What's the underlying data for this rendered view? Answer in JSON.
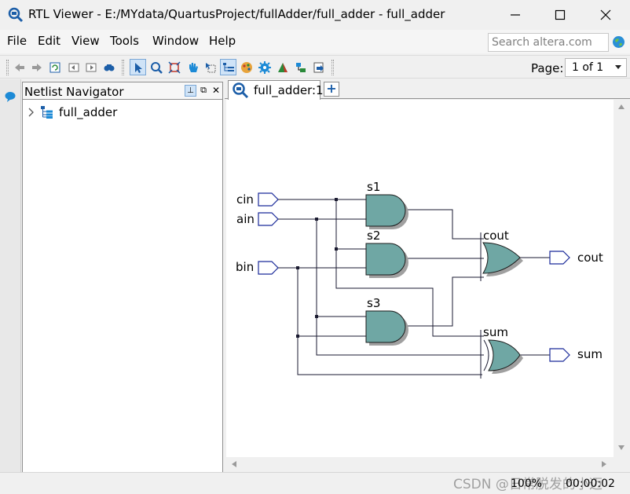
{
  "window": {
    "title": "RTL Viewer - E:/MYdata/QuartusProject/fullAdder/full_adder - full_adder"
  },
  "menu": [
    "File",
    "Edit",
    "View",
    "Tools",
    "Window",
    "Help"
  ],
  "search": {
    "placeholder": "Search altera.com"
  },
  "toolbar": {
    "page_label": "Page:",
    "page_value": "1 of 1",
    "icons": [
      "back-icon",
      "forward-icon",
      "refresh-icon",
      "go-back-icon",
      "go-forward-icon",
      "find-icon",
      "select-icon",
      "zoom-icon",
      "fit-icon",
      "hand-icon",
      "area-select-icon",
      "netlist-navigator-icon",
      "color-icon",
      "settings-icon",
      "filter-icon",
      "hierarchy-icon",
      "export-icon"
    ]
  },
  "navigator": {
    "title": "Netlist Navigator",
    "tree": [
      {
        "label": "full_adder",
        "expanded": false
      }
    ]
  },
  "tabs": [
    {
      "label": "full_adder:1"
    }
  ],
  "schematic": {
    "inputs": [
      "cin",
      "ain",
      "bin"
    ],
    "outputs": [
      "cout",
      "sum"
    ],
    "gates": [
      {
        "name": "s1",
        "type": "and"
      },
      {
        "name": "s2",
        "type": "and"
      },
      {
        "name": "s3",
        "type": "and"
      },
      {
        "name": "cout",
        "type": "or"
      },
      {
        "name": "sum",
        "type": "xor"
      }
    ],
    "gate_color": "#6fa7a4"
  },
  "status": {
    "zoom": "100%",
    "time": "00:00:02",
    "watermark": "CSDN @日常脱发的小迈"
  }
}
